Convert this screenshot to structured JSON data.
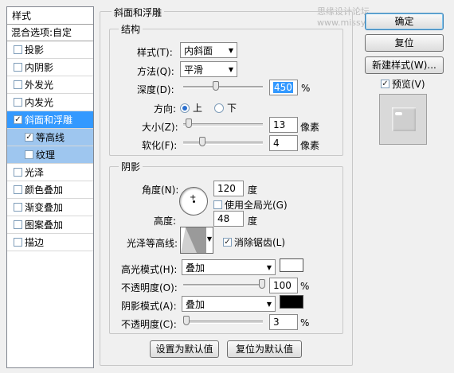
{
  "watermark": "思缘设计论坛 www.missyuan.com",
  "sidebar": {
    "header": "样式",
    "blend": "混合选项:自定",
    "items": [
      {
        "label": "投影",
        "checked": false
      },
      {
        "label": "内阴影",
        "checked": false
      },
      {
        "label": "外发光",
        "checked": false
      },
      {
        "label": "内发光",
        "checked": false
      },
      {
        "label": "斜面和浮雕",
        "checked": true
      },
      {
        "label": "等高线",
        "checked": true
      },
      {
        "label": "纹理",
        "checked": false
      },
      {
        "label": "光泽",
        "checked": false
      },
      {
        "label": "颜色叠加",
        "checked": false
      },
      {
        "label": "渐变叠加",
        "checked": false
      },
      {
        "label": "图案叠加",
        "checked": false
      },
      {
        "label": "描边",
        "checked": false
      }
    ]
  },
  "bevel": {
    "title": "斜面和浮雕",
    "structure_title": "结构",
    "style_label": "样式(T):",
    "style_value": "内斜面",
    "technique_label": "方法(Q):",
    "technique_value": "平滑",
    "depth_label": "深度(D):",
    "depth_value": "450",
    "depth_unit": "%",
    "direction_label": "方向:",
    "dir_up": "上",
    "dir_down": "下",
    "size_label": "大小(Z):",
    "size_value": "13",
    "size_unit": "像素",
    "soften_label": "软化(F):",
    "soften_value": "4",
    "soften_unit": "像素"
  },
  "shading": {
    "title": "阴影",
    "angle_label": "角度(N):",
    "angle_value": "120",
    "angle_unit": "度",
    "global_light": "使用全局光(G)",
    "altitude_label": "高度:",
    "altitude_value": "48",
    "altitude_unit": "度",
    "gloss_label": "光泽等高线:",
    "antialias": "消除锯齿(L)",
    "highlight_label": "高光模式(H):",
    "highlight_value": "叠加",
    "highlight_color": "#ffffff",
    "hl_opacity_label": "不透明度(O):",
    "hl_opacity_value": "100",
    "hl_opacity_unit": "%",
    "shadow_label": "阴影模式(A):",
    "shadow_value": "叠加",
    "shadow_color": "#000000",
    "sh_opacity_label": "不透明度(C):",
    "sh_opacity_value": "3",
    "sh_opacity_unit": "%"
  },
  "footer": {
    "make_default": "设置为默认值",
    "reset_default": "复位为默认值"
  },
  "right": {
    "ok": "确定",
    "reset": "复位",
    "new_style": "新建样式(W)...",
    "preview": "预览(V)"
  }
}
